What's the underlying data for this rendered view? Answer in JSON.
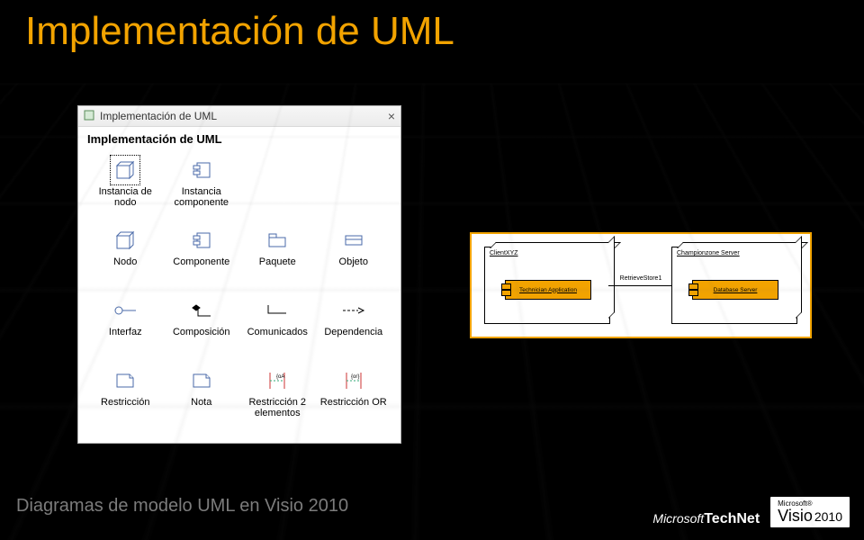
{
  "title": "Implementación de UML",
  "footer": "Diagramas de modelo UML en Visio 2010",
  "branding": {
    "technet_ms": "Microsoft",
    "technet_tn": "TechNet",
    "visio_ms": "Microsoft®",
    "visio_name": "Visio",
    "visio_year": "2010"
  },
  "panel": {
    "titlebar": "Implementación de UML",
    "header": "Implementación de UML",
    "shapes": [
      {
        "id": "instancia-nodo",
        "label": "Instancia de nodo",
        "icon": "node3d",
        "selected": true
      },
      {
        "id": "instancia-componente",
        "label": "Instancia componente",
        "icon": "component"
      },
      {
        "id": "nodo",
        "label": "Nodo",
        "icon": "node3d"
      },
      {
        "id": "componente",
        "label": "Componente",
        "icon": "component"
      },
      {
        "id": "paquete",
        "label": "Paquete",
        "icon": "package"
      },
      {
        "id": "objeto",
        "label": "Objeto",
        "icon": "object"
      },
      {
        "id": "interfaz",
        "label": "Interfaz",
        "icon": "interface"
      },
      {
        "id": "composicion",
        "label": "Composición",
        "icon": "composition"
      },
      {
        "id": "comunicados",
        "label": "Comunicados",
        "icon": "communicates"
      },
      {
        "id": "dependencia",
        "label": "Dependencia",
        "icon": "dependency"
      },
      {
        "id": "restriccion",
        "label": "Restricción",
        "icon": "note"
      },
      {
        "id": "nota",
        "label": "Nota",
        "icon": "note"
      },
      {
        "id": "restriccion-2",
        "label": "Restricción 2 elementos",
        "icon": "constraint2"
      },
      {
        "id": "restriccion-or",
        "label": "Restricción OR",
        "icon": "constraintor"
      }
    ]
  },
  "diagram": {
    "node1": {
      "title": "ClientXYZ",
      "component": "Technician Application"
    },
    "node2": {
      "title": "Championzone Server",
      "component": "Database Server"
    },
    "connection": "RetrieveStore1"
  }
}
